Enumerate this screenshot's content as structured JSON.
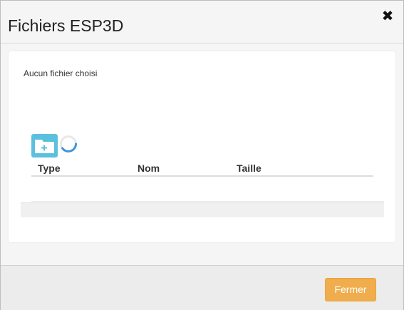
{
  "header": {
    "title": "Fichiers ESP3D",
    "close_glyph": "✖"
  },
  "body": {
    "file_input_status": "Aucun fichier choisi",
    "new_folder_icon": "folder-plus-icon",
    "loading_icon": "spinner-icon",
    "table": {
      "columns": [
        "Type",
        "Nom",
        "Taille"
      ],
      "rows": []
    }
  },
  "footer": {
    "close_label": "Fermer"
  },
  "colors": {
    "accent_info": "#5bc0de",
    "button_warning": "#f0ad4e",
    "spinner": "#3d96db"
  }
}
